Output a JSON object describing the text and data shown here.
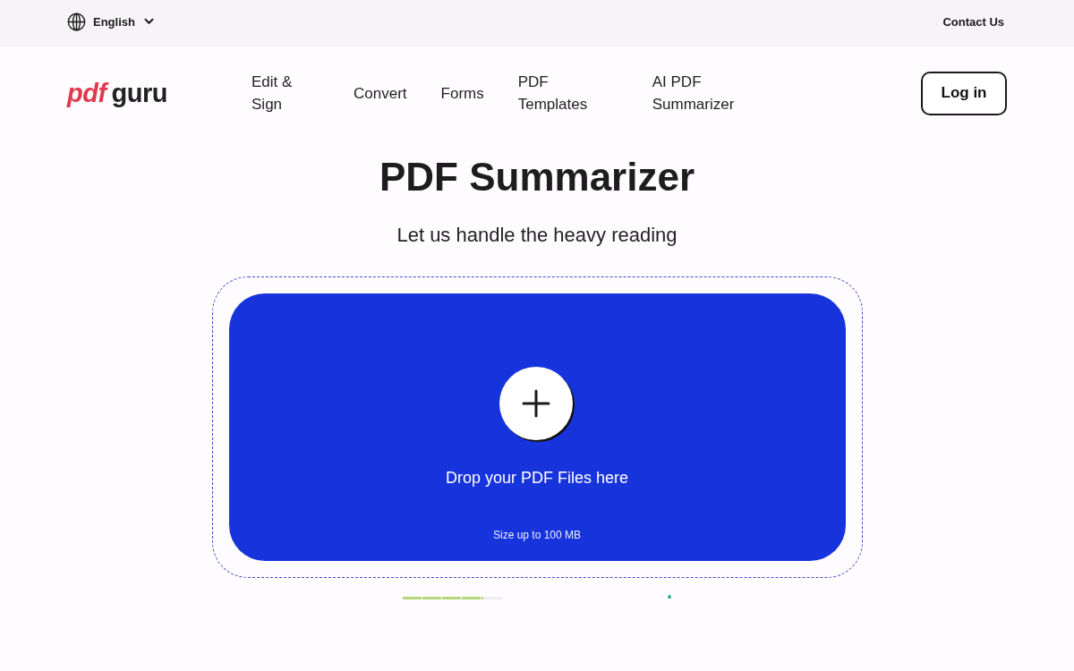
{
  "top_bar": {
    "language": "English",
    "contact_link": "Contact Us"
  },
  "header": {
    "logo": {
      "mark": "pdf",
      "word": "guru"
    },
    "nav": [
      "Edit & Sign",
      "Convert",
      "Forms",
      "PDF Templates",
      "AI PDF Summarizer"
    ],
    "login_button": "Log in"
  },
  "hero": {
    "title": "PDF Summarizer",
    "subtitle": "Let us handle the heavy reading"
  },
  "upload": {
    "prompt": "Drop your PDF Files here",
    "size_note": "Size up to 100 MB"
  },
  "progress": {
    "level": 0.8
  }
}
